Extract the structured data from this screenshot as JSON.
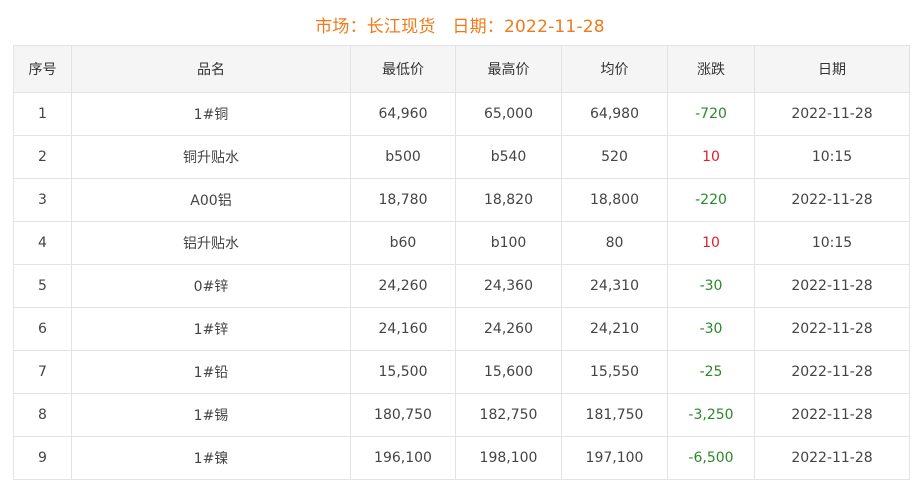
{
  "header": {
    "market_label": "市场：",
    "market_value": "长江现货",
    "date_label": "日期：",
    "date_value": "2022-11-28"
  },
  "colors": {
    "title": "#f07a1a",
    "rise": "#e0202a",
    "fall": "#2a8a2a",
    "header_bg": "#f5f5f5",
    "border": "#e3e3e3"
  },
  "table": {
    "columns": [
      "序号",
      "品名",
      "最低价",
      "最高价",
      "均价",
      "涨跌",
      "日期"
    ],
    "rows": [
      {
        "no": "1",
        "name": "1#铜",
        "low": "64,960",
        "high": "65,000",
        "avg": "64,980",
        "change": "-720",
        "trend": "down",
        "date": "2022-11-28"
      },
      {
        "no": "2",
        "name": "铜升贴水",
        "low": "b500",
        "high": "b540",
        "avg": "520",
        "change": "10",
        "trend": "up",
        "date": "10:15"
      },
      {
        "no": "3",
        "name": "A00铝",
        "low": "18,780",
        "high": "18,820",
        "avg": "18,800",
        "change": "-220",
        "trend": "down",
        "date": "2022-11-28"
      },
      {
        "no": "4",
        "name": "铝升贴水",
        "low": "b60",
        "high": "b100",
        "avg": "80",
        "change": "10",
        "trend": "up",
        "date": "10:15"
      },
      {
        "no": "5",
        "name": "0#锌",
        "low": "24,260",
        "high": "24,360",
        "avg": "24,310",
        "change": "-30",
        "trend": "down",
        "date": "2022-11-28"
      },
      {
        "no": "6",
        "name": "1#锌",
        "low": "24,160",
        "high": "24,260",
        "avg": "24,210",
        "change": "-30",
        "trend": "down",
        "date": "2022-11-28"
      },
      {
        "no": "7",
        "name": "1#铅",
        "low": "15,500",
        "high": "15,600",
        "avg": "15,550",
        "change": "-25",
        "trend": "down",
        "date": "2022-11-28"
      },
      {
        "no": "8",
        "name": "1#锡",
        "low": "180,750",
        "high": "182,750",
        "avg": "181,750",
        "change": "-3,250",
        "trend": "down",
        "date": "2022-11-28"
      },
      {
        "no": "9",
        "name": "1#镍",
        "low": "196,100",
        "high": "198,100",
        "avg": "197,100",
        "change": "-6,500",
        "trend": "down",
        "date": "2022-11-28"
      }
    ]
  }
}
